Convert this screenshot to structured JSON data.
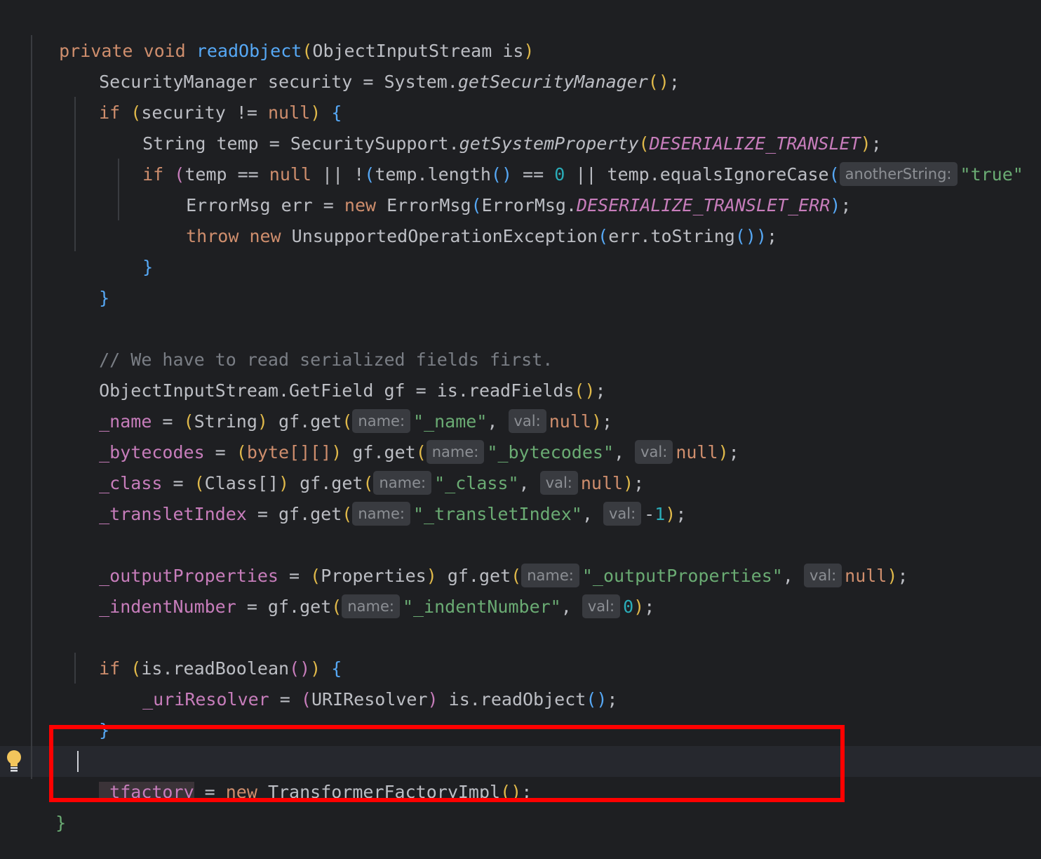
{
  "editor": {
    "lines": {
      "l1": {
        "kw1": "private",
        "kw2": "void",
        "method": "readObject",
        "p_open": "(",
        "rest": "ObjectInputStream is",
        "p_close": ")"
      },
      "l2": {
        "a": "SecurityManager security = System.",
        "call": "getSecurityManager",
        "paren": "()",
        "end": ";"
      },
      "l3": {
        "kw": "if",
        "s1": " ",
        "po": "(",
        "a": "security != ",
        "null": "null",
        "pc": ")",
        "s2": " ",
        "brace": "{"
      },
      "l4": {
        "a": "String temp = SecuritySupport.",
        "call": "getSystemProperty",
        "po": "(",
        "const": "DESERIALIZE_TRANSLET",
        "pc": ")",
        "end": ";"
      },
      "l5": {
        "kw": "if",
        "s1": " ",
        "po": "(",
        "a": "temp == ",
        "null": "null",
        "b": " || !",
        "po2": "(",
        "c": "temp.length",
        "paren": "()",
        "d": " == ",
        "zero": "0",
        "e": " || temp.equalsIgnoreCase",
        "po3": "(",
        "hint": "anotherString:",
        "str": "\"true\""
      },
      "l6": {
        "a": "ErrorMsg err = ",
        "kw": "new",
        "b": " ErrorMsg",
        "po": "(",
        "c": "ErrorMsg.",
        "const": "DESERIALIZE_TRANSLET_ERR",
        "pc": ")",
        "end": ";"
      },
      "l7": {
        "kw1": "throw",
        "kw2": "new",
        "a": " UnsupportedOperationException",
        "po": "(",
        "b": "err.toString",
        "paren": "()",
        "pc": ")",
        "end": ";"
      },
      "l8": {
        "brace": "}"
      },
      "l9": {
        "brace": "}"
      },
      "l10": {
        "comment": "// We have to read serialized fields first."
      },
      "l11": {
        "a": "ObjectInputStream.GetField gf = is.readFields",
        "paren": "()",
        "end": ";"
      },
      "l12": {
        "field": "_name",
        "a": " = ",
        "po": "(",
        "cast": "String",
        "pc": ")",
        "b": " gf.get",
        "po2": "(",
        "hint1": "name:",
        "str": "\"_name\"",
        "c": ", ",
        "hint2": "val:",
        "null": "null",
        "pc2": ")",
        "end": ";"
      },
      "l13": {
        "field": "_bytecodes",
        "a": " = ",
        "po": "(",
        "cast": "byte[][]",
        "pc": ")",
        "b": " gf.get",
        "po2": "(",
        "hint1": "name:",
        "str": "\"_bytecodes\"",
        "c": ", ",
        "hint2": "val:",
        "null": "null",
        "pc2": ")",
        "end": ";"
      },
      "l14": {
        "field": "_class",
        "a": " = ",
        "po": "(",
        "cast": "Class[]",
        "pc": ")",
        "b": " gf.get",
        "po2": "(",
        "hint1": "name:",
        "str": "\"_class\"",
        "c": ", ",
        "hint2": "val:",
        "null": "null",
        "pc2": ")",
        "end": ";"
      },
      "l15": {
        "field": "_transletIndex",
        "a": " = gf.get",
        "po": "(",
        "hint1": "name:",
        "str": "\"_transletIndex\"",
        "c": ", ",
        "hint2": "val:",
        "minus": "-",
        "one": "1",
        "pc": ")",
        "end": ";"
      },
      "l16": {
        "field": "_outputProperties",
        "a": " = ",
        "po": "(",
        "cast": "Properties",
        "pc": ")",
        "b": " gf.get",
        "po2": "(",
        "hint1": "name:",
        "str": "\"_outputProperties\"",
        "c": ", ",
        "hint2": "val:",
        "null": "null",
        "pc2": ")",
        "end": ";"
      },
      "l17": {
        "field": "_indentNumber",
        "a": " = gf.get",
        "po": "(",
        "hint1": "name:",
        "str": "\"_indentNumber\"",
        "c": ", ",
        "hint2": "val:",
        "zero": "0",
        "pc": ")",
        "end": ";"
      },
      "l18": {
        "kw": "if",
        "s1": " ",
        "po": "(",
        "a": "is.readBoolean",
        "paren": "()",
        "pc": ")",
        "s2": " ",
        "brace": "{"
      },
      "l19": {
        "field": "_uriResolver",
        "a": " = ",
        "po": "(",
        "cast": "URIResolver",
        "pc": ")",
        "b": " is.readObject",
        "paren": "()",
        "end": ";"
      },
      "l20": {
        "brace": "}"
      },
      "l21": {
        "field": "_tfactory",
        "a": " = ",
        "kw": "new",
        "b": " TransformerFactoryImpl",
        "paren": "()",
        "end": ";"
      },
      "l22": {
        "brace": "}"
      }
    },
    "colors": {
      "background": "#1e1f22",
      "keyword": "#cf8e6d",
      "method": "#56a8f5",
      "field": "#c77dbb",
      "string": "#6aab73",
      "number": "#2aacb8",
      "comment": "#7a7e85",
      "highlight_box": "#ff0000"
    },
    "intention_icon": "lightbulb-icon"
  }
}
